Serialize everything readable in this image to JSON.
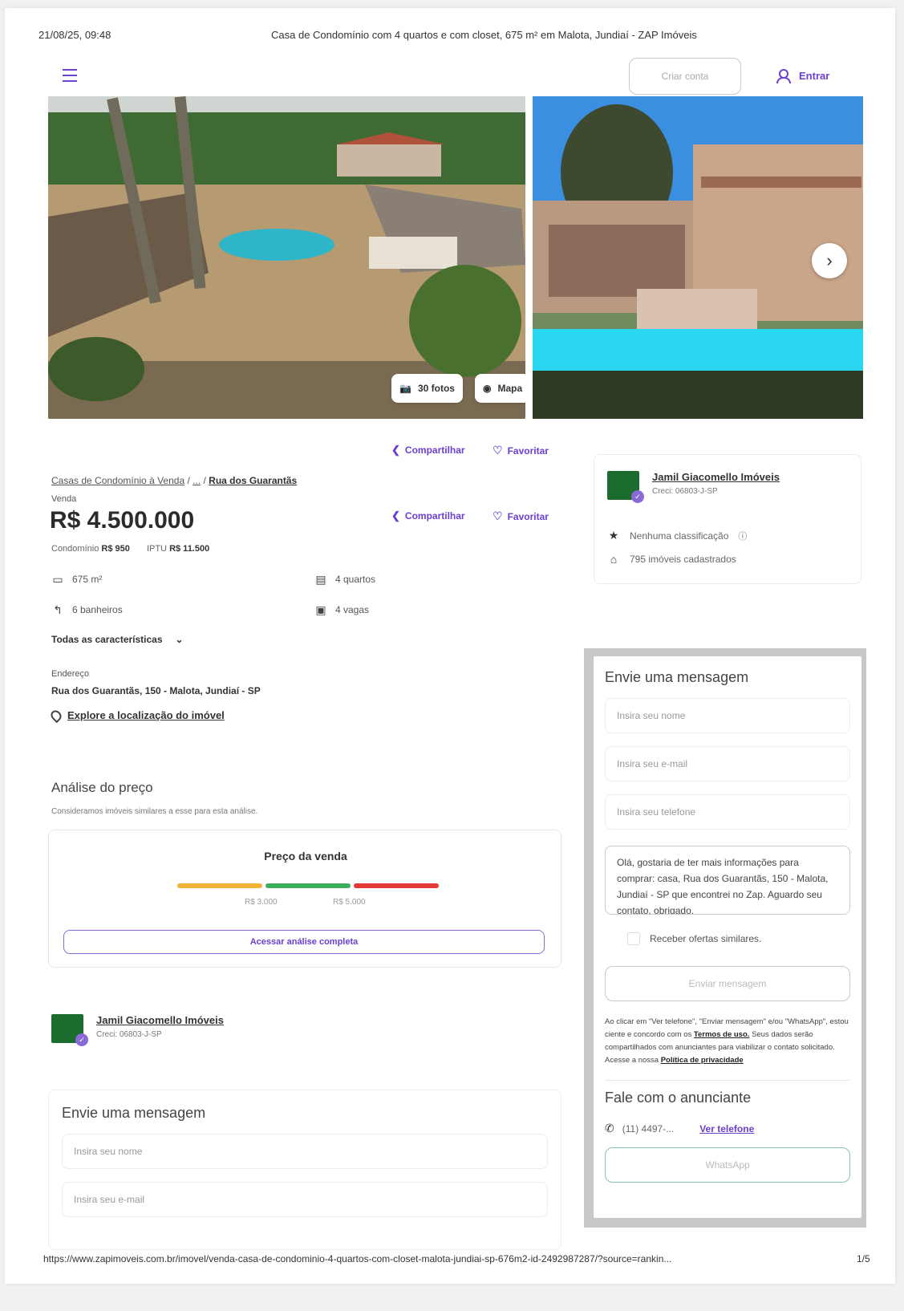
{
  "print_header": {
    "date": "21/08/25, 09:48",
    "title": "Casa de Condomínio com 4 quartos e com closet, 675 m² em Malota, Jundiaí - ZAP Imóveis"
  },
  "header": {
    "criar_conta": "Criar conta",
    "entrar": "Entrar"
  },
  "gallery": {
    "photos_label": "30 fotos",
    "map_label": "Mapa"
  },
  "actions": {
    "share": "Compartilhar",
    "favorite": "Favoritar"
  },
  "listing": {
    "breadcrumb": [
      "Casas de Condomínio à Venda",
      "...",
      "Rua dos Guarantãs"
    ],
    "tag": "Venda",
    "price": "R$ 4.500.000",
    "condo_label": "Condomínio",
    "condo_value": "R$ 950",
    "iptu_label": "IPTU",
    "iptu_value": "R$ 11.500",
    "features": {
      "area": "675 m²",
      "bedrooms": "4 quartos",
      "bathrooms": "6 banheiros",
      "parking": "4 vagas"
    },
    "all_features": "Todas as características",
    "address_label": "Endereço",
    "address": "Rua dos Guarantãs, 150 - Malota, Jundiaí - SP",
    "explore": "Explore a localização do imóvel"
  },
  "price_analysis": {
    "title": "Análise do preço",
    "subtitle": "Consideramos imóveis similares a esse para esta análise.",
    "card_title": "Preço da venda",
    "low_value": "R$ 3.000",
    "high_value": "R$ 5.000",
    "button": "Acessar análise completa",
    "colors": {
      "low": "#f2b233",
      "mid": "#3fae5a",
      "high": "#e53935"
    }
  },
  "advertiser": {
    "name": "Jamil Giacomello Imóveis",
    "creci": "Creci: 06803-J-SP",
    "rating": "Nenhuma classificação",
    "listings": "795 imóveis cadastrados"
  },
  "message_form": {
    "title": "Envie uma mensagem",
    "name_placeholder": "Insira seu nome",
    "email_placeholder": "Insira seu e-mail",
    "phone_placeholder": "Insira seu telefone",
    "message": "Olá, gostaria de ter mais informações para comprar: casa, Rua dos Guarantãs, 150 - Malota, Jundiaí - SP que encontrei no Zap. Aguardo seu contato, obrigado.",
    "similar_offers": "Receber ofertas similares.",
    "send_button": "Enviar mensagem",
    "terms_pre": "Ao clicar em \"Ver telefone\", \"Enviar mensagem\" e/ou \"WhatsApp\", estou ciente e concordo com os",
    "terms_link": "Termos de uso.",
    "privacy_pre": "Seus dados serão compartilhados com anunciantes para viabilizar o contato solicitado. Acesse a nossa",
    "privacy_link": "Política de privacidade"
  },
  "contact": {
    "title": "Fale com o anunciante",
    "phone": "(11) 4497-...",
    "show_phone": "Ver telefone",
    "whatsapp": "WhatsApp"
  },
  "bottom_form": {
    "title": "Envie uma mensagem",
    "name_placeholder": "Insira seu nome",
    "email_placeholder": "Insira seu e-mail"
  },
  "footer": {
    "url": "https://www.zapimoveis.com.br/imovel/venda-casa-de-condominio-4-quartos-com-closet-malota-jundiai-sp-676m2-id-2492987287/?source=rankin...",
    "page": "1/5"
  },
  "brand": {
    "accent": "#6b3fd1"
  }
}
